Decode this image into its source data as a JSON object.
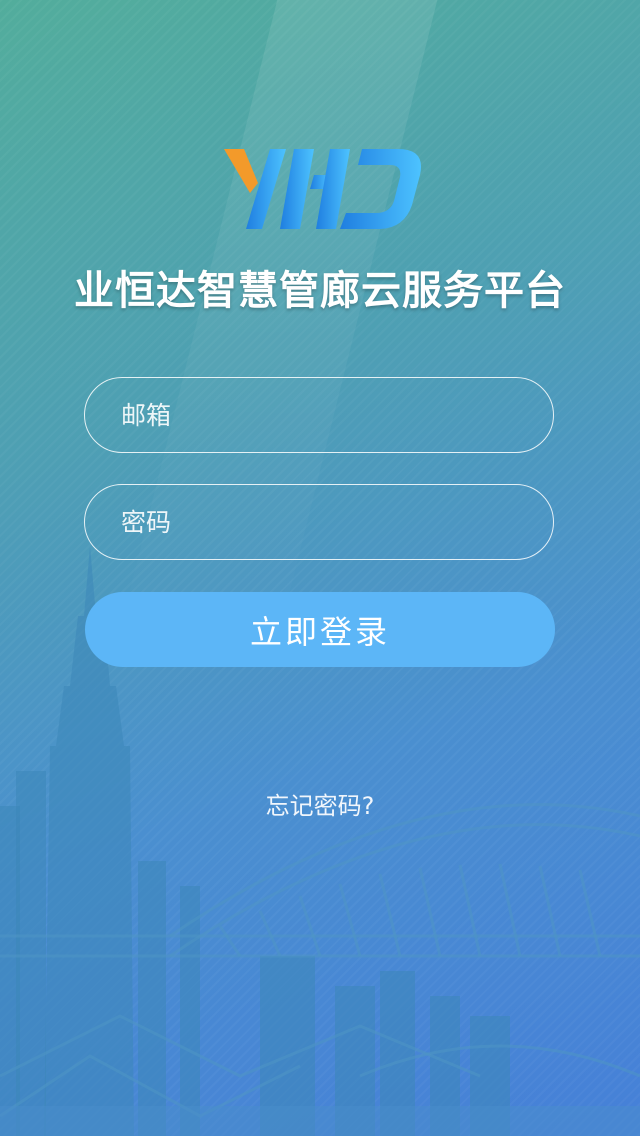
{
  "app": {
    "title": "业恒达智慧管廊云服务平台"
  },
  "login": {
    "email_placeholder": "邮箱",
    "password_placeholder": "密码",
    "submit_label": "立即登录",
    "forgot_label": "忘记密码?"
  },
  "theme": {
    "button_color": "#5cb6f7",
    "logo_accent_orange": "#f39a2a",
    "logo_blue": "#2b8ee6"
  }
}
